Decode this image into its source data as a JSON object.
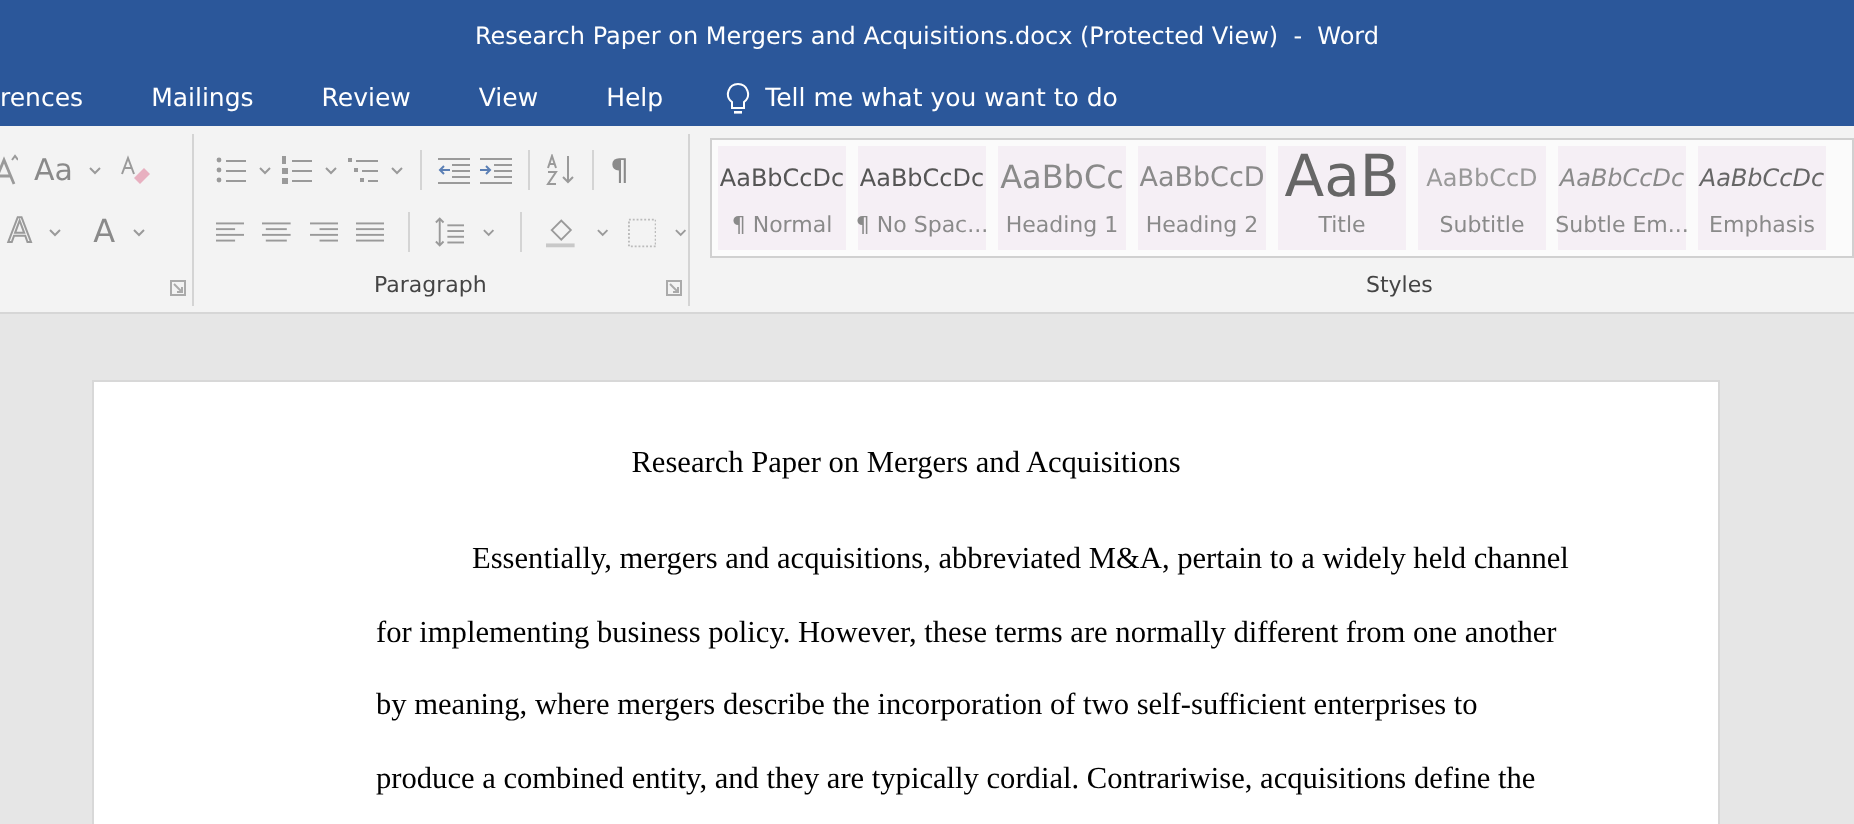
{
  "window": {
    "title": "Research Paper on Mergers and Acquisitions.docx (Protected View)  -  Word"
  },
  "tabs": [
    {
      "label": "rences",
      "selected": false
    },
    {
      "label": "Mailings",
      "selected": false
    },
    {
      "label": "Review",
      "selected": false
    },
    {
      "label": "View",
      "selected": false
    },
    {
      "label": "Help",
      "selected": false
    }
  ],
  "tell_me": "Tell me what you want to do",
  "font_group": {
    "change_case": "Aa",
    "text_effects": "A",
    "font_color": "A"
  },
  "paragraph_group": {
    "label": "Paragraph",
    "show_marks": "¶"
  },
  "styles_group": {
    "label": "Styles",
    "styles": [
      {
        "kind": "normal",
        "preview": "AaBbCcDc",
        "name": "¶ Normal"
      },
      {
        "kind": "nospacing",
        "preview": "AaBbCcDc",
        "name": "¶ No Spac..."
      },
      {
        "kind": "heading1",
        "preview": "AaBbCc",
        "name": "Heading 1"
      },
      {
        "kind": "heading2",
        "preview": "AaBbCcD",
        "name": "Heading 2"
      },
      {
        "kind": "title",
        "preview": "AaB",
        "name": "Title"
      },
      {
        "kind": "subtitle",
        "preview": "AaBbCcD",
        "name": "Subtitle"
      },
      {
        "kind": "subtle",
        "preview": "AaBbCcDc",
        "name": "Subtle Em..."
      },
      {
        "kind": "emphasis",
        "preview": "AaBbCcDc",
        "name": "Emphasis"
      }
    ]
  },
  "document": {
    "heading": "Research Paper on Mergers and Acquisitions",
    "body_lines": [
      "Essentially, mergers and acquisitions, abbreviated M&A, pertain to a widely held channel",
      "for implementing business policy. However, these terms are normally different from one another",
      "by meaning, where mergers describe the incorporation of two self-sufficient enterprises to",
      "produce a combined entity, and they are typically cordial. Contrariwise, acquisitions define the"
    ]
  }
}
